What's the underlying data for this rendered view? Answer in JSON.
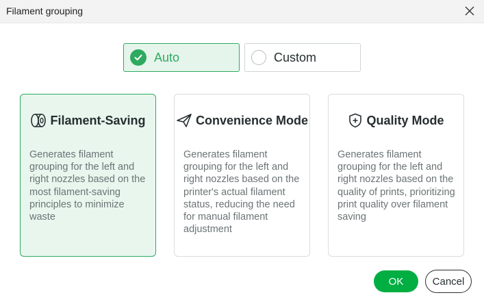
{
  "dialog": {
    "title": "Filament grouping",
    "close_icon": "close-icon"
  },
  "modes": {
    "auto_label": "Auto",
    "custom_label": "Custom",
    "selected": "Auto",
    "accent_color": "#2fa960"
  },
  "cards": [
    {
      "title": "Filament-Saving",
      "icon": "filament-spool-icon",
      "selected": true,
      "description": "Generates filament grouping for the left and right nozzles based on the most filament-saving principles to minimize waste"
    },
    {
      "title": "Convenience Mode",
      "icon": "paper-plane-icon",
      "selected": false,
      "description": "Generates filament grouping for the left and right nozzles based on the printer's actual filament status, reducing the need for manual filament adjustment"
    },
    {
      "title": "Quality Mode",
      "icon": "shield-plus-icon",
      "selected": false,
      "description": "Generates filament grouping for the left and right nozzles based on the quality of prints, prioritizing print quality over filament saving"
    }
  ],
  "buttons": {
    "ok_label": "OK",
    "cancel_label": "Cancel",
    "ok_color": "#00ae42"
  }
}
